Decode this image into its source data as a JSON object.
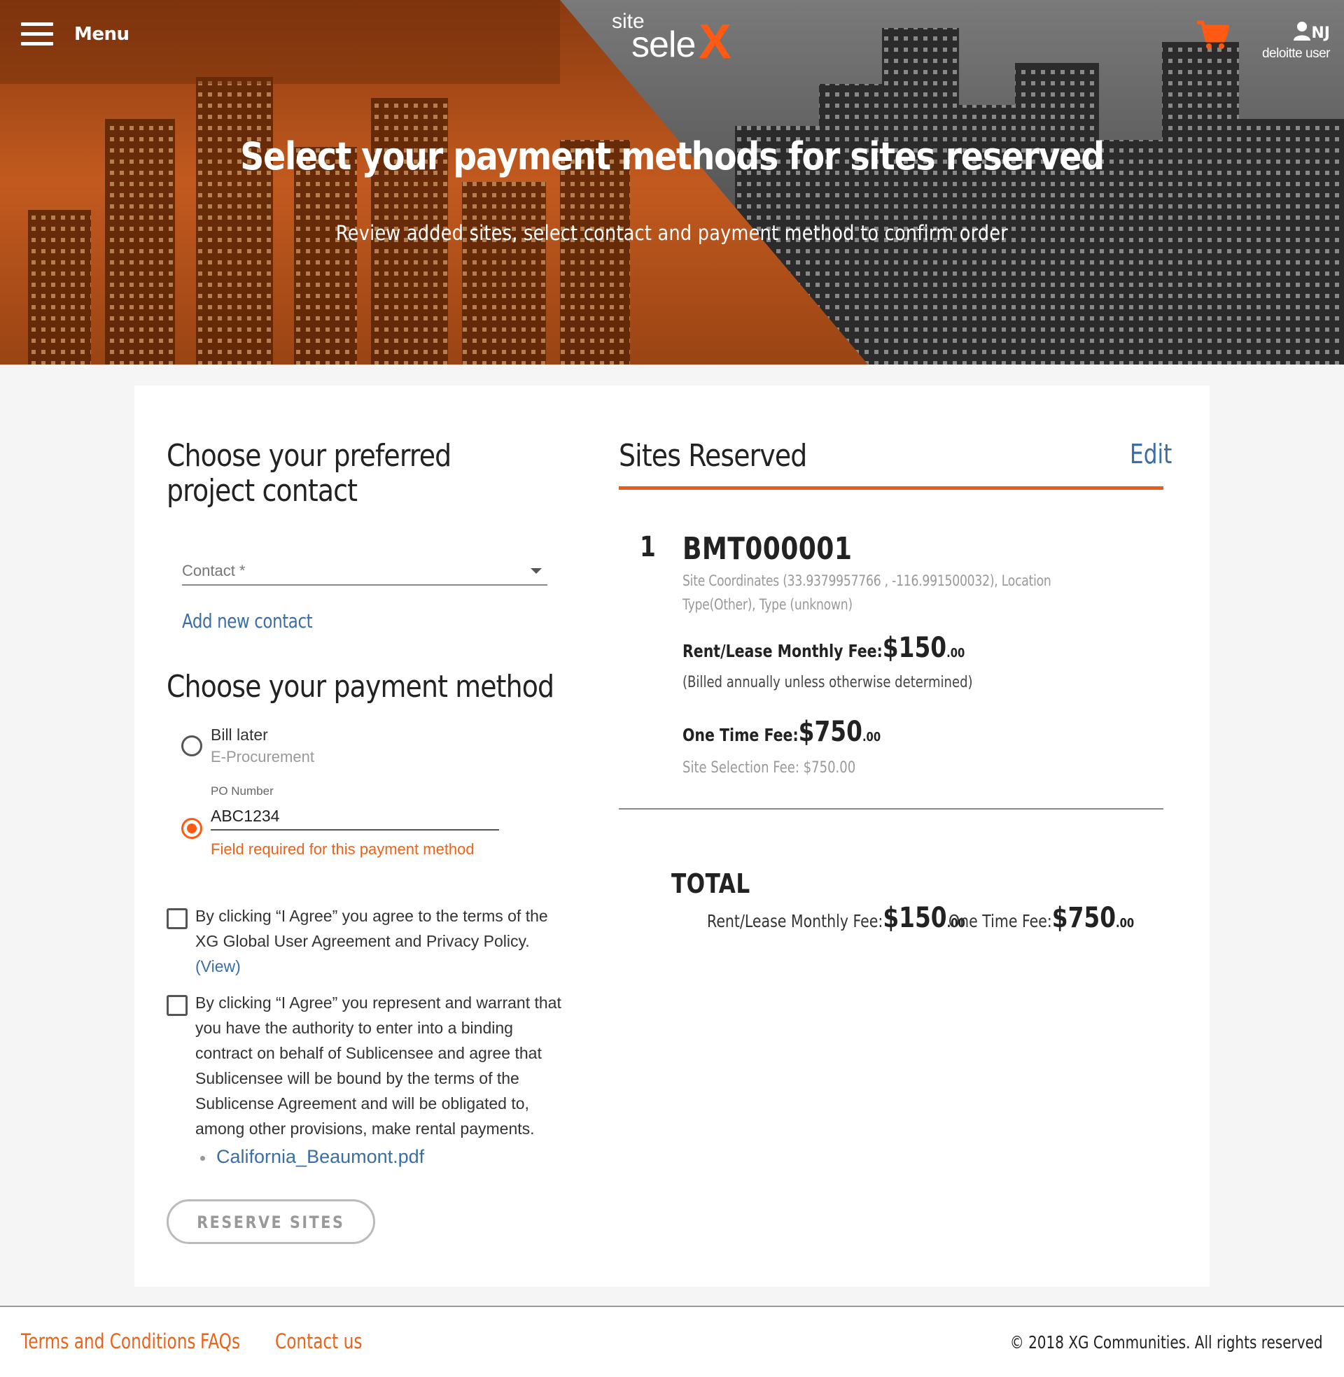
{
  "header": {
    "menu_label": "Menu",
    "logo_site": "site",
    "logo_sele": "sele",
    "logo_x": "X",
    "user_initials": "NJ",
    "user_name": "deloitte user",
    "title": "Select your payment methods for sites reserved",
    "subtitle": "Review added sites, select contact and payment method to confirm order"
  },
  "contact": {
    "heading": "Choose your preferred project contact",
    "select_placeholder": "Contact *",
    "add_link": "Add new contact"
  },
  "payment": {
    "heading": "Choose your payment method",
    "option1_title": "Bill later",
    "option1_sub": "E-Procurement",
    "po_label": "PO Number",
    "po_value": "ABC1234",
    "po_error": "Field required for this payment method",
    "selected": "po"
  },
  "agreements": {
    "agree1": "By clicking “I Agree” you agree to the terms of the XG Global User Agreement and Privacy Policy.",
    "view_link": "(View)",
    "agree2": "By clicking “I Agree” you represent and warrant that you have the authority to enter into a binding contract on behalf of Sublicensee and agree that Sublicensee will be bound by the terms of the Sublicense Agreement and will be obligated to, among other provisions, make rental payments.",
    "file_link": "California_Beaumont.pdf"
  },
  "reserve_button": "RESERVE SITES",
  "sites": {
    "heading": "Sites Reserved",
    "edit_label": "Edit",
    "items": [
      {
        "index": "1",
        "id": "BMT000001",
        "details": "Site Coordinates (33.9379957766 , -116.991500032), Location Type(Other), Type (unknown)",
        "monthly_label": "Rent/Lease Monthly Fee:",
        "monthly_amount": "$150",
        "monthly_cents": ".00",
        "monthly_note": "(Billed annually unless otherwise determined)",
        "onetime_label": "One Time Fee:",
        "onetime_amount": "$750",
        "onetime_cents": ".00",
        "onetime_note": "Site Selection Fee: $750.00"
      }
    ]
  },
  "total": {
    "label": "TOTAL",
    "monthly_label": "Rent/Lease Monthly Fee:",
    "monthly_amount": "$150",
    "monthly_cents": ".00",
    "onetime_label": "One Time Fee:",
    "onetime_amount": "$750",
    "onetime_cents": ".00"
  },
  "footer": {
    "links": [
      "Terms and Conditions",
      "FAQs",
      "Contact us"
    ],
    "copyright": "© 2018 XG Communities. All rights reserved"
  },
  "colors": {
    "accent": "#ea5b1a",
    "link": "#3a6ea5",
    "hero_orange": "#c2551a"
  }
}
